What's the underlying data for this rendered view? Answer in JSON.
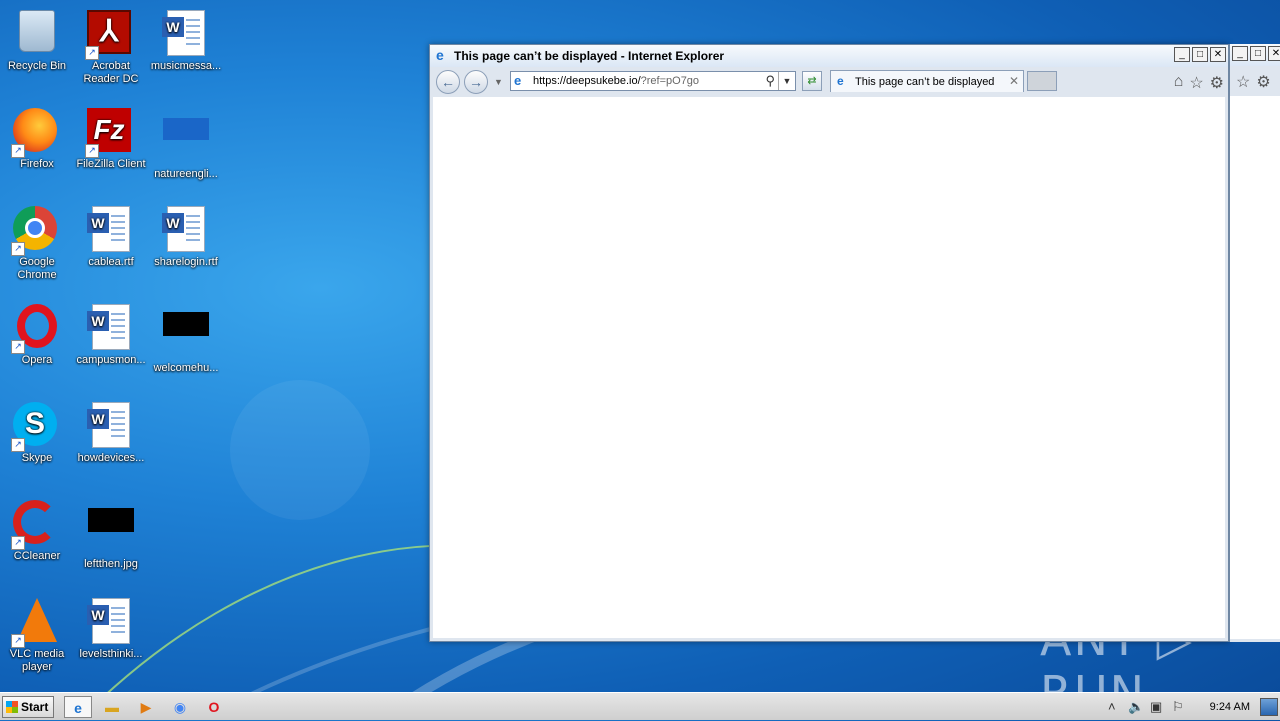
{
  "desktop": {
    "icons": [
      {
        "label": "Recycle Bin"
      },
      {
        "label": "Acrobat Reader DC"
      },
      {
        "label": "musicmessa..."
      },
      {
        "label": "Firefox"
      },
      {
        "label": "FileZilla Client"
      },
      {
        "label": "natureengli..."
      },
      {
        "label": "Google Chrome"
      },
      {
        "label": "cablea.rtf"
      },
      {
        "label": "sharelogin.rtf"
      },
      {
        "label": "Opera"
      },
      {
        "label": "campusmon..."
      },
      {
        "label": "welcomehu..."
      },
      {
        "label": "Skype"
      },
      {
        "label": "howdevices..."
      },
      {
        "label": "CCleaner"
      },
      {
        "label": "leftthen.jpg"
      },
      {
        "label": "VLC media player"
      },
      {
        "label": "levelsthinki..."
      }
    ],
    "watermark": "ANY ▷ RUN"
  },
  "browser": {
    "title": "This page can’t be displayed - Internet Explorer",
    "address": {
      "host": "https://deepsukebe.io/",
      "query": "?ref=pO7go"
    },
    "tab_label": "This page can’t be displayed",
    "window_controls": {
      "minimize": "_",
      "maximize": "□",
      "close": "✕"
    }
  },
  "taskbar": {
    "start_label": "Start",
    "clock": "9:24 AM"
  },
  "colors": {
    "desktop_blue": "#1f82d6",
    "title_bar": "#dbe7f5",
    "taskbar": "#d8d8d8"
  }
}
